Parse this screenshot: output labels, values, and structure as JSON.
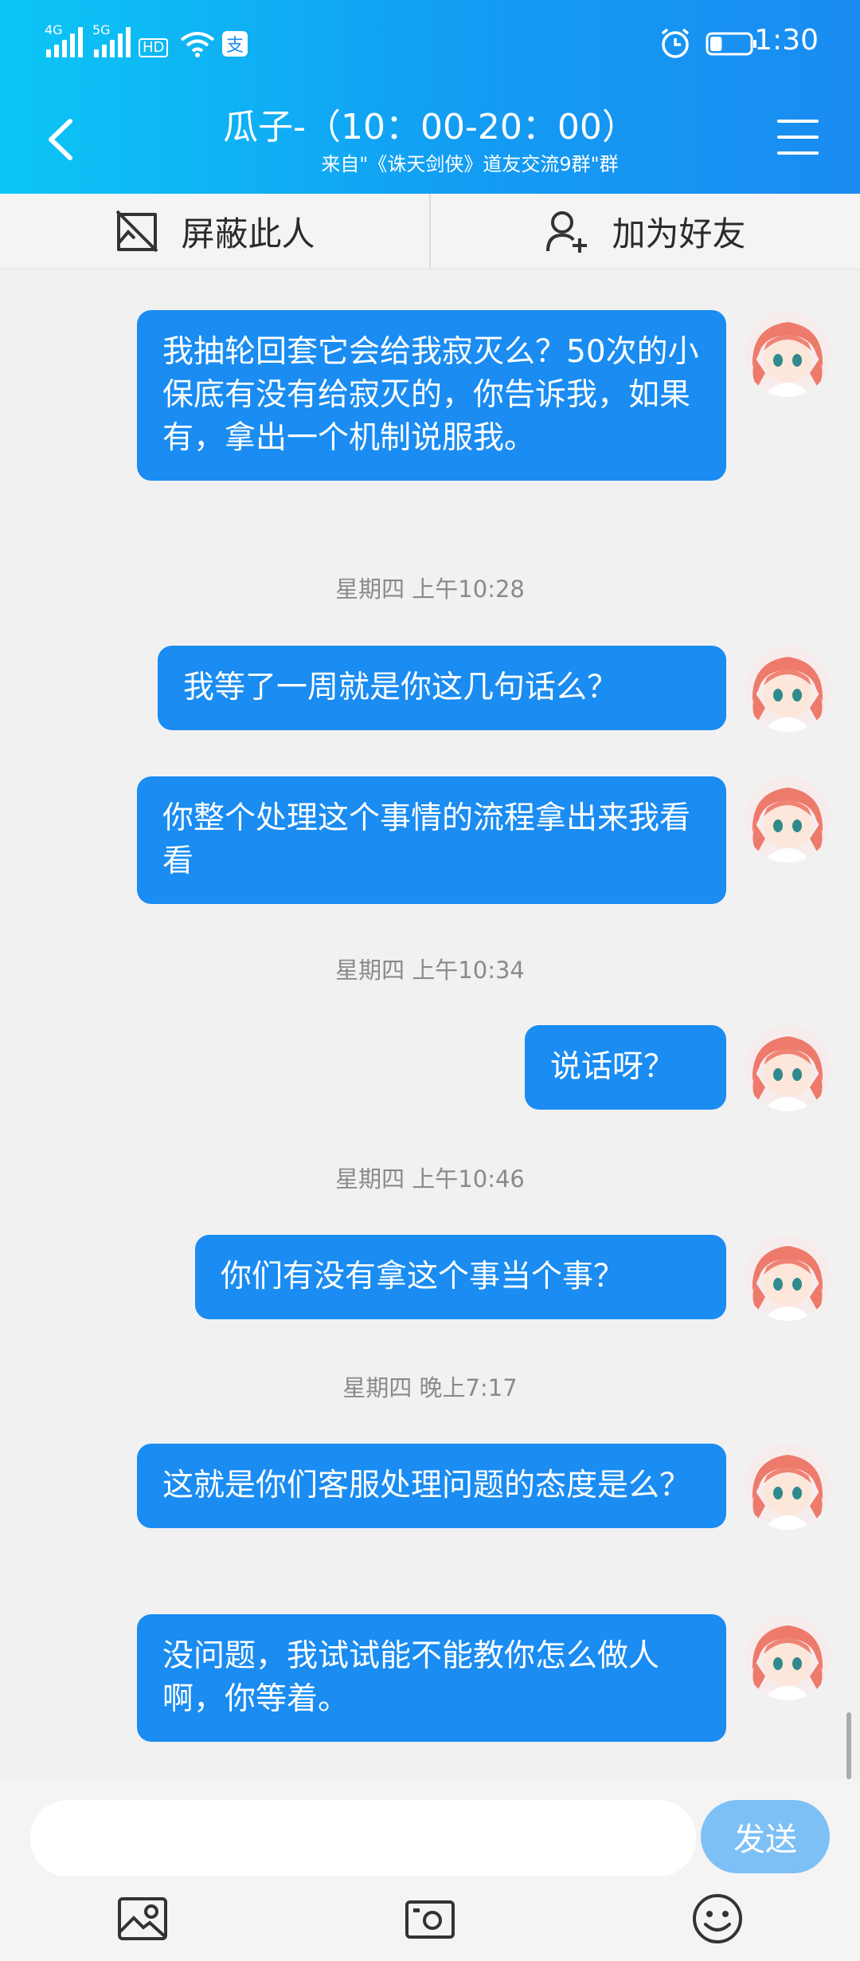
{
  "status_bar": {
    "network_1": "4G",
    "network_2": "5G",
    "hd_badge": "HD",
    "time": "1:30",
    "battery_level": 0.3
  },
  "header": {
    "title": "瓜子-（10：00-20：00）",
    "subtitle": "来自\"《诛天剑侠》道友交流9群\"群"
  },
  "actions": {
    "block_label": "屏蔽此人",
    "add_friend_label": "加为好友"
  },
  "messages": [
    {
      "text": "我抽轮回套它会给我寂灭么？50次的小保底有没有给寂灭的，你告诉我，如果有，拿出一个机制说服我。"
    },
    {
      "timestamp": "星期四 上午10:28"
    },
    {
      "text": "我等了一周就是你这几句话么？"
    },
    {
      "text": "你整个处理这个事情的流程拿出来我看看"
    },
    {
      "timestamp": "星期四 上午10:34"
    },
    {
      "text": "说话呀？"
    },
    {
      "timestamp": "星期四 上午10:46"
    },
    {
      "text": "你们有没有拿这个事当个事？"
    },
    {
      "timestamp": "星期四 晚上7:17"
    },
    {
      "text": "这就是你们客服处理问题的态度是么？"
    },
    {
      "text": "没问题，我试试能不能教你怎么做人啊，你等着。"
    }
  ],
  "input": {
    "placeholder": "",
    "send_label": "发送"
  },
  "colors": {
    "bubble": "#1a8cf2",
    "header_start": "#0bc6f5",
    "header_end": "#1a8cf2",
    "send_button": "#7dc0f6"
  }
}
